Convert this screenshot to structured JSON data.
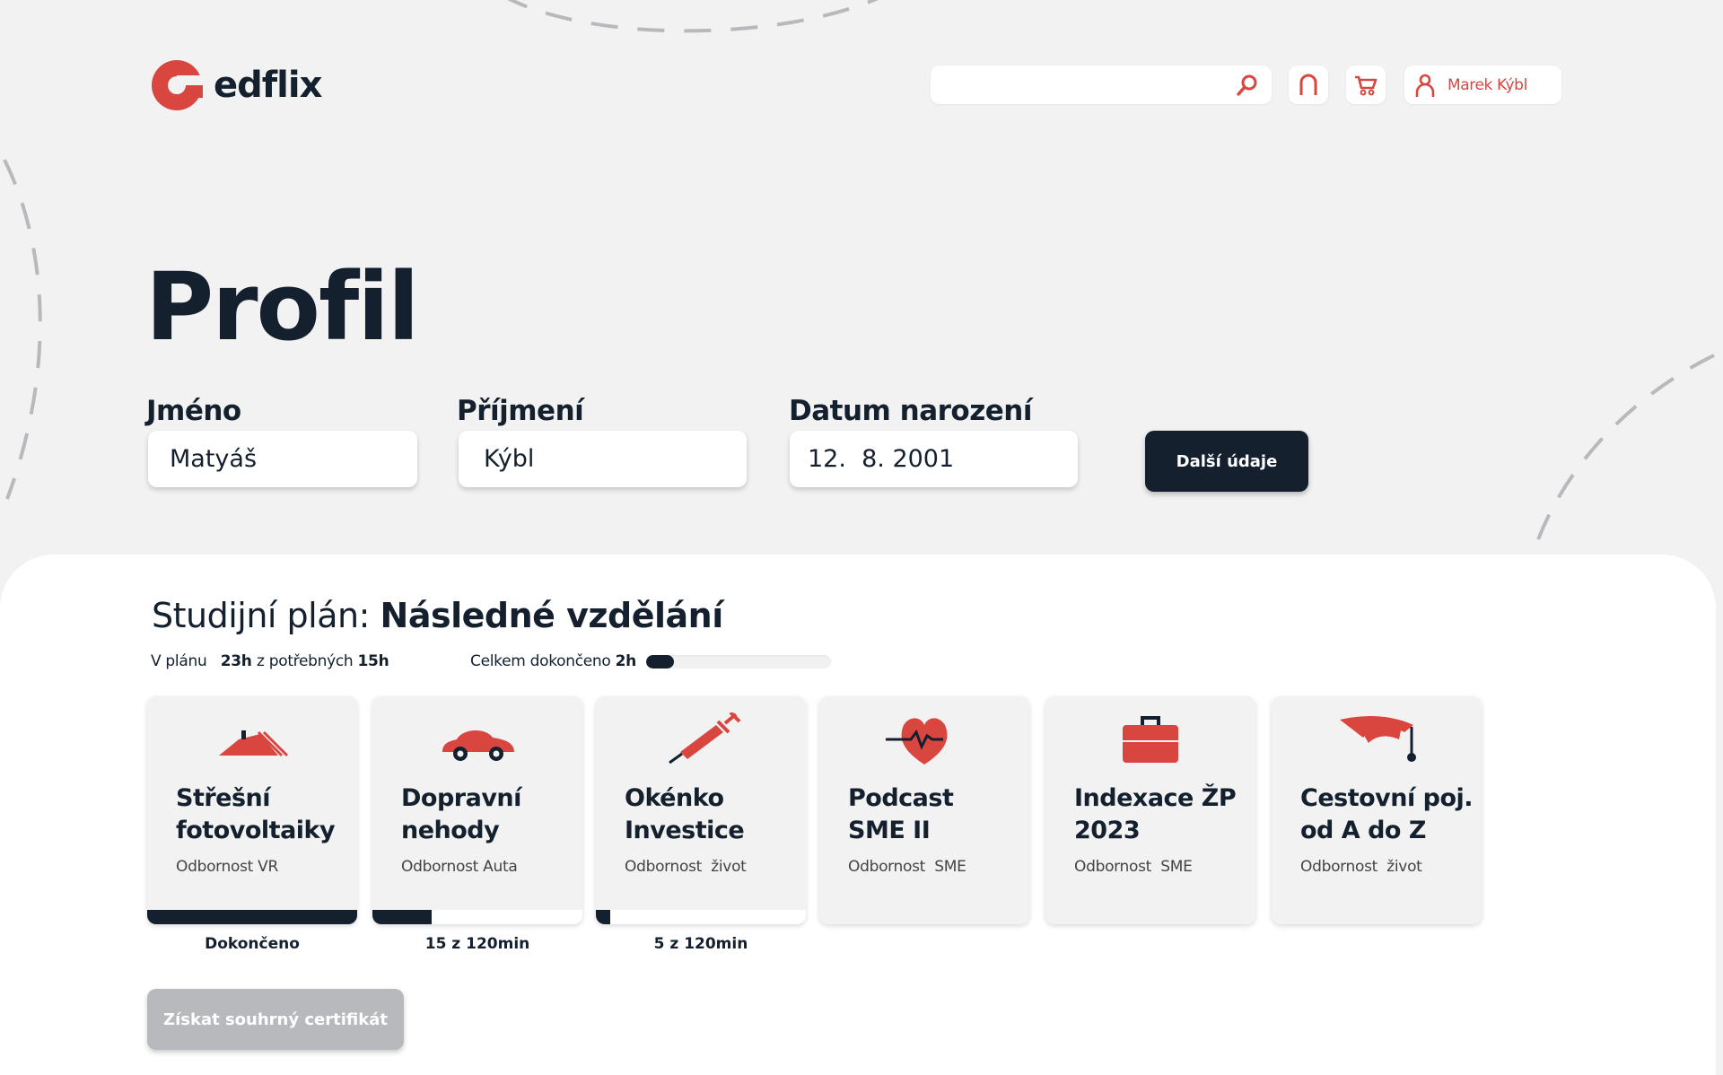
{
  "brand": {
    "name": "edflix",
    "accent": "#d9453f",
    "dark": "#14202e"
  },
  "header": {
    "search_placeholder": "",
    "user_name": "Marek Kýbl"
  },
  "profile": {
    "title": "Profil",
    "first_name_label": "Jméno",
    "first_name_value": "Matyáš",
    "last_name_label": "Příjmení",
    "last_name_value": "Kýbl",
    "birthdate_label": "Datum narození",
    "birthdate_value": "12.  8. 2001",
    "more_button": "Další údaje"
  },
  "plan": {
    "title_prefix": "Studijní plán:",
    "title_name": "Následné vzdělání",
    "planned_label": "V plánu",
    "planned_value": "23h",
    "required_label": "z potřebných",
    "required_value": "15h",
    "completed_label": "Celkem dokončeno",
    "completed_value": "2h",
    "completed_progress": 0.15,
    "courses": [
      {
        "icon": "roof-icon",
        "title_line1": "Střešní",
        "title_line2": "fotovoltaiky",
        "subtitle": "Odbornost VR",
        "progress": 1.0,
        "status": "Dokončeno"
      },
      {
        "icon": "car-icon",
        "title_line1": "Dopravní",
        "title_line2": "nehody",
        "subtitle": "Odbornost Auta",
        "progress": 0.28,
        "status": "15 z 120min"
      },
      {
        "icon": "syringe-icon",
        "title_line1": "Okénko",
        "title_line2": "Investice",
        "subtitle": "Odbornost  život",
        "progress": 0.07,
        "status": "5 z 120min"
      },
      {
        "icon": "heart-pulse-icon",
        "title_line1": "Podcast",
        "title_line2": "SME II",
        "subtitle": "Odbornost  SME",
        "progress": null,
        "status": ""
      },
      {
        "icon": "briefcase-icon",
        "title_line1": "Indexace ŽP",
        "title_line2": "2023",
        "subtitle": "Odbornost  SME",
        "progress": null,
        "status": ""
      },
      {
        "icon": "graduation-cap-icon",
        "title_line1": "Cestovní poj.",
        "title_line2": "od A do Z",
        "subtitle": "Odbornost  život",
        "progress": null,
        "status": ""
      }
    ],
    "certificate_button": "Získat souhrný certifikát"
  }
}
